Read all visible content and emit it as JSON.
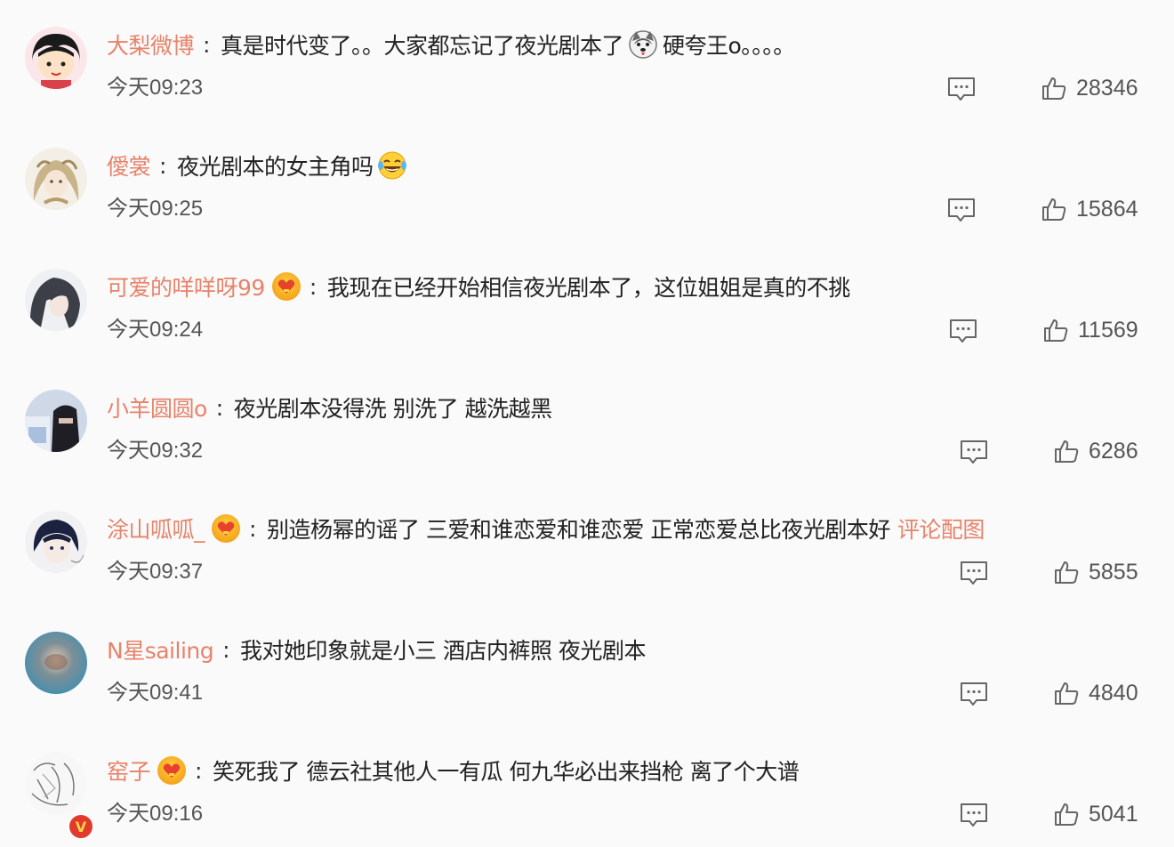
{
  "comments": [
    {
      "username": "大梨微博",
      "content": "真是时代变了。。大家都忘记了夜光剧本了",
      "emoji": "husky-emoji",
      "content_after": "硬夸王o。。。。",
      "time": "今天09:23",
      "likes": "28346",
      "avatar": "cartoon-girl-avatar",
      "badge": false
    },
    {
      "username": "僾裳",
      "content": "夜光剧本的女主角吗",
      "emoji": "laugh-cry-emoji",
      "time": "今天09:25",
      "likes": "15864",
      "avatar": "anime-girl-avatar",
      "badge": false
    },
    {
      "username": "可爱的咩咩呀99",
      "content": "我现在已经开始相信夜光剧本了，这位姐姐是真的不挑",
      "time": "今天09:24",
      "likes": "11569",
      "avatar": "dark-haired-avatar",
      "badge": true
    },
    {
      "username": "小羊圆圆o",
      "content": "夜光剧本没得洗 别洗了 越洗越黑",
      "time": "今天09:32",
      "likes": "6286",
      "avatar": "masked-person-avatar",
      "badge": false
    },
    {
      "username": "涂山呱呱_",
      "content": "别造杨幂的谣了 三爱和谁恋爱和谁恋爱 正常恋爱总比夜光剧本好",
      "link": "评论配图",
      "time": "今天09:37",
      "likes": "5855",
      "avatar": "anime-boy-avatar",
      "badge": true
    },
    {
      "username": "N星sailing",
      "content": "我对她印象就是小三 酒店内裤照 夜光剧本",
      "time": "今天09:41",
      "likes": "4840",
      "avatar": "blurred-avatar",
      "badge": false
    },
    {
      "username": "窑子",
      "content": "笑死我了 德云社其他人一有瓜 何九华必出来挡枪 离了个大谱",
      "time": "今天09:16",
      "likes": "5041",
      "avatar": "sketch-avatar",
      "badge": true,
      "verified_mark": "V"
    }
  ],
  "colors": {
    "username": "#e7836b",
    "text": "#222222",
    "meta": "#555555",
    "background": "#fafafa"
  },
  "icons": {
    "reply": "comment-bubble-icon",
    "like": "thumbs-up-icon",
    "member_badge": "heart-badge-icon"
  }
}
